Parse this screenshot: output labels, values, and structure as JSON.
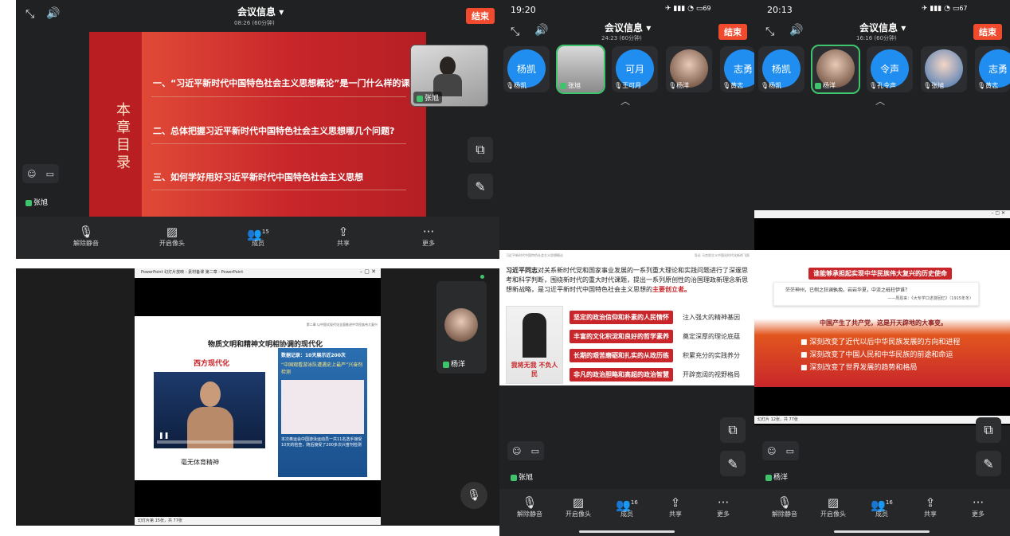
{
  "p1": {
    "meeting_info": "会议信息",
    "duration": "08:26 (60分钟)",
    "end_label": "结束",
    "slide": {
      "vertical_title": "本章目录",
      "items": [
        "一、“习近平新时代中国特色社会主义思想概论”是一门什么样的课程",
        "二、总体把握习近平新时代中国特色社会主义思想哪几个问题?",
        "三、如何学好用好习近平新时代中国特色社会主义思想"
      ]
    },
    "video_name": "张旭",
    "self_name": "张旭",
    "toolbar": [
      {
        "label": "解除静音",
        "icon": "mic-off-icon"
      },
      {
        "label": "开启像头",
        "icon": "camera-off-icon"
      },
      {
        "label": "成员",
        "icon": "members-icon",
        "badge": "15"
      },
      {
        "label": "共享",
        "icon": "share-icon"
      },
      {
        "label": "更多",
        "icon": "more-icon"
      }
    ]
  },
  "p2": {
    "window_title": "PowerPoint 幻灯片放映 - 素材备课 第二章 - PowerPoint",
    "slide_header": "第二章 以中国式现代化全面推进中华民族伟大复兴",
    "slide_title": "物质文明和精神文明相协调的现代化",
    "left_heading": "西方现代化",
    "left_caption": "毫无体育精神",
    "right_caption_top": "数据记录：10天展示近200次",
    "right_caption_mid": "“中国观看游泳队遭遇史上最严”兴奋剂检测",
    "right_caption_bottom": "本次奥运会中国游泳运动员一共11名选手接受10天的检查，随后接受了200多次兴奋剂检测",
    "status_text": "幻灯片第 15张，共 77张",
    "video_name": "杨洋"
  },
  "p3": {
    "clock": "19:20",
    "battery": "69",
    "meeting_info": "会议信息",
    "duration": "24:23 (60分钟)",
    "end_label": "结束",
    "participants": [
      {
        "avatar_text": "杨凯",
        "label": "杨凯"
      },
      {
        "avatar_text": "",
        "label": "张旭"
      },
      {
        "avatar_text": "可月",
        "label": "王可月"
      },
      {
        "avatar_text": "",
        "label": "杨洋"
      },
      {
        "avatar_text": "志勇",
        "label": "黄志"
      }
    ],
    "slide_header_left": "习近平新时代中国特色社会主义思想概论",
    "slide_header_right": "导论 马克思主义中国化时代化新的飞跃",
    "paragraph_lead": "习近平同志",
    "paragraph": "对关系新时代党和国家事业发展的一系列重大理论和实践问题进行了深邃思考和科学判断，围绕新时代的重大时代课题，提出一系列原创性的治国理政新理念新思想新战略，是习近平新时代中国特色社会主义思想的",
    "paragraph_tail": "主要创立者。",
    "poster_text": "我将无我 不负人民",
    "rows": [
      {
        "left": "坚定的政治信仰和朴素的人民情怀",
        "right": "注入强大的精神基因"
      },
      {
        "left": "丰富的文化积淀和良好的哲学素养",
        "right": "奠定深厚的理论底蕴"
      },
      {
        "left": "长期的艰苦磨砺和扎实的从政历练",
        "right": "积累充分的实践养分"
      },
      {
        "left": "非凡的政治胆略和高超的政治智慧",
        "right": "开辟宽阔的视野格局"
      }
    ],
    "self_name": "张旭",
    "toolbar": [
      {
        "label": "解除静音",
        "icon": "mic-off-icon"
      },
      {
        "label": "开启像头",
        "icon": "camera-off-icon"
      },
      {
        "label": "成员",
        "icon": "members-icon",
        "badge": "16"
      },
      {
        "label": "共享",
        "icon": "share-icon"
      },
      {
        "label": "更多",
        "icon": "more-icon"
      }
    ]
  },
  "p4": {
    "clock": "20:13",
    "battery": "67",
    "meeting_info": "会议信息",
    "duration": "16:16 (60分钟)",
    "end_label": "结束",
    "participants": [
      {
        "avatar_text": "杨凯",
        "label": "杨凯"
      },
      {
        "avatar_text": "",
        "label": "杨洋"
      },
      {
        "avatar_text": "令声",
        "label": "孔令声"
      },
      {
        "avatar_text": "",
        "label": "张旭"
      },
      {
        "avatar_text": "志勇",
        "label": "黄志"
      }
    ],
    "slide_heading": "谁能够承担起实现中华民族伟大复兴的历史使命",
    "quote": "茫茫神州，已侧之狂澜孰挽。岩岩华夏，中流之砥柱伊谁？",
    "quote_source": "——周恩来：《大专学口述游回忆》（1915年冬）",
    "highlight": "中国产生了共产党，这是开天辟地的大事变。",
    "bullets": [
      "深刻改变了近代以后中华民族发展的方向和进程",
      "深刻改变了中国人民和中华民族的前途和命运",
      "深刻改变了世界发展的趋势和格局"
    ],
    "status_text": "幻灯片 12张，共 77张",
    "self_name": "杨洋",
    "toolbar": [
      {
        "label": "解除静音",
        "icon": "mic-off-icon"
      },
      {
        "label": "开启像头",
        "icon": "camera-off-icon"
      },
      {
        "label": "成员",
        "icon": "members-icon",
        "badge": "16"
      },
      {
        "label": "共享",
        "icon": "share-icon"
      },
      {
        "label": "更多",
        "icon": "more-icon"
      }
    ]
  },
  "colors": {
    "accent_red": "#f04b2e",
    "mic_green": "#3ec46d",
    "avatar_blue": "#1f8ef0"
  }
}
